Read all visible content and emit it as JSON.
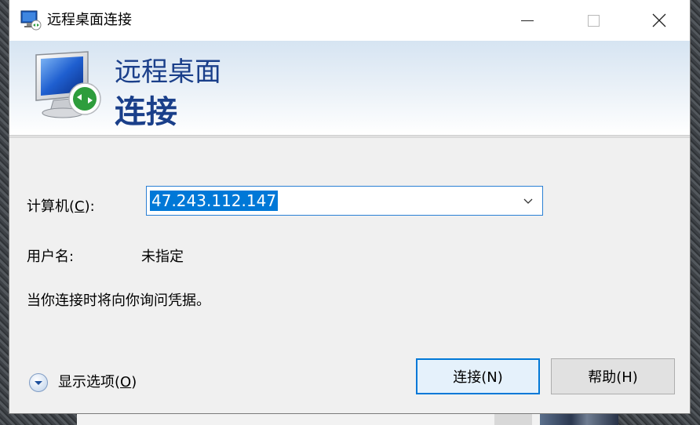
{
  "window": {
    "title": "远程桌面连接"
  },
  "banner": {
    "line1": "远程桌面",
    "line2": "连接"
  },
  "form": {
    "computer_label_prefix": "计算机(",
    "computer_label_key": "C",
    "computer_label_suffix": "):",
    "computer_value": "47.243.112.147",
    "user_label": "用户名:",
    "user_value": "未指定",
    "info_text": "当你连接时将向你询问凭据。"
  },
  "bottom": {
    "options_prefix": "显示选项(",
    "options_key": "O",
    "options_suffix": ")",
    "connect_label": "连接(N)",
    "help_label": "帮助(H)"
  },
  "icons": {
    "title_icon": "remote-desktop-icon",
    "banner_icon": "remote-desktop-monitor-icon",
    "options_icon": "chevron-down-circle-icon",
    "combo_arrow": "chevron-down-icon"
  },
  "colors": {
    "accent": "#0078d7",
    "banner_text": "#1a3f8a"
  }
}
